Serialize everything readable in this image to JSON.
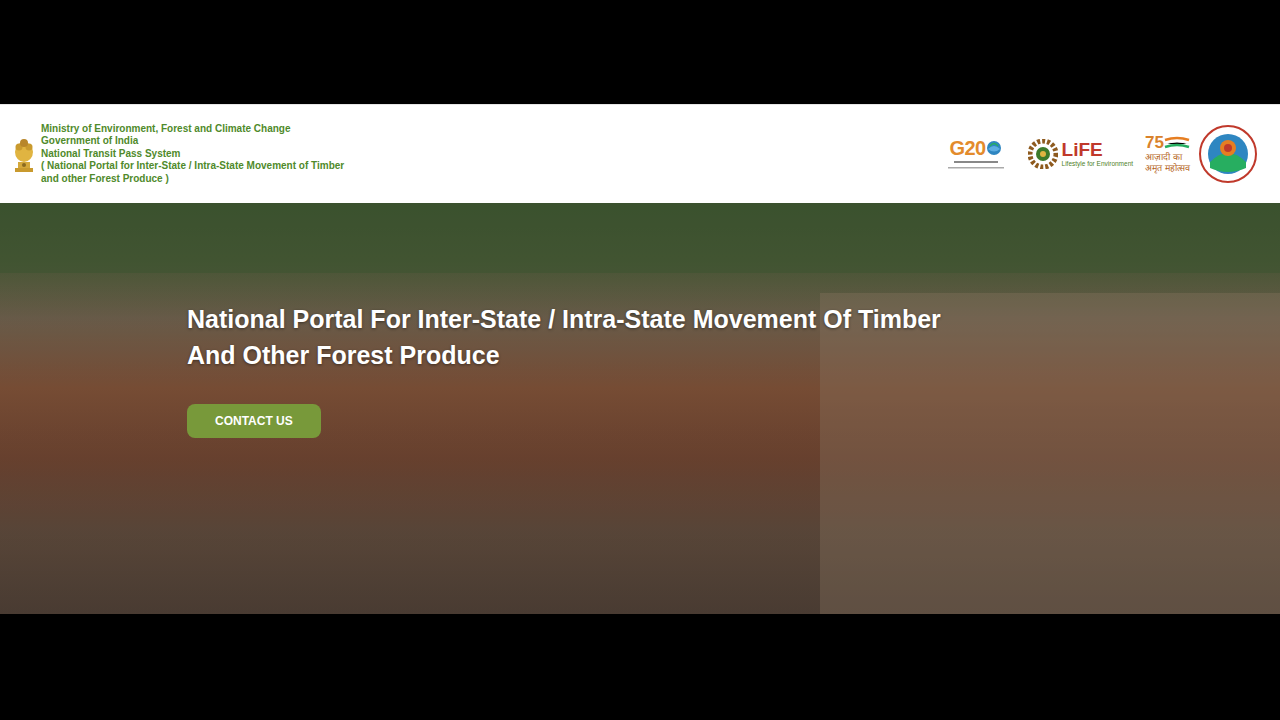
{
  "header": {
    "ministry_lines": [
      "Ministry of Environment, Forest and Climate Change",
      "Government of India",
      "National Transit Pass System",
      "( National Portal for Inter-State / Intra-State Movement of Timber",
      "and other Forest Produce )"
    ]
  },
  "logos": {
    "g20": "G20",
    "life": "LiFE",
    "life_sub": "Lifestyle for Environment",
    "azadi_num": "75",
    "azadi_lines": [
      "आज़ादी का",
      "अमृत महोत्सव"
    ]
  },
  "hero": {
    "title": "National Portal For Inter-State / Intra-State Movement Of Timber And Other Forest Produce",
    "button": "CONTACT US"
  }
}
